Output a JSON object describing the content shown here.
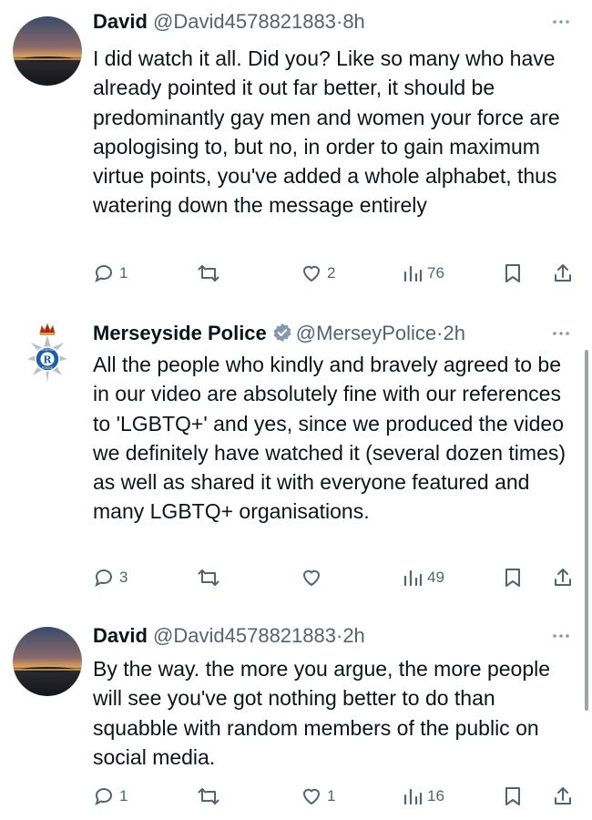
{
  "tweets": [
    {
      "name": "David",
      "handle": "@David4578821883",
      "separator": "·",
      "time": "8h",
      "verified": false,
      "text": "I did watch it all. Did you? Like so many who have already pointed it out far better, it should be predominantly gay men and women your force are apologising to, but no, in order to gain maximum virtue points, you've added a whole alphabet, thus watering down the message entirely",
      "replies": "1",
      "reposts": "",
      "likes": "2",
      "views": "76"
    },
    {
      "name": "Merseyside Police",
      "handle": "@MerseyPolice",
      "separator": "·",
      "time": "2h",
      "verified": true,
      "text": "All the people who kindly and bravely agreed to be in our video are absolutely fine with our references to 'LGBTQ+' and yes, since we produced the video we definitely have watched it (several dozen times) as well as shared it with everyone featured and many LGBTQ+ organisations.",
      "replies": "3",
      "reposts": "",
      "likes": "",
      "views": "49",
      "logo_text": {
        "top": "MERSEYSIDE",
        "bottom": "POLICE",
        "center": "R"
      }
    },
    {
      "name": "David",
      "handle": "@David4578821883",
      "separator": "·",
      "time": "2h",
      "verified": false,
      "text": "By the way. the more you argue, the more people will see you've got nothing better to do than squabble with random members of the public on social media.",
      "replies": "1",
      "reposts": "",
      "likes": "1",
      "views": "16"
    }
  ],
  "icons": {
    "reply": "reply-icon",
    "repost": "repost-icon",
    "like": "heart-icon",
    "views": "views-icon",
    "bookmark": "bookmark-icon",
    "share": "share-icon",
    "more": "more-icon",
    "verified": "verified-badge-icon"
  },
  "colors": {
    "text": "#0f1419",
    "secondary": "#536471",
    "verified_badge": "#829aab",
    "police_blue": "#1f5fa8"
  }
}
